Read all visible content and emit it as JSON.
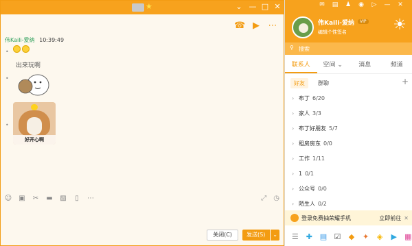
{
  "chat": {
    "sender": "伟Kaili-爱纳",
    "time": "10:39:49",
    "sticker_text": "出来玩啊",
    "photo_caption": "好开心啊",
    "close_label": "关闭(C)",
    "send_label": "发送(S)",
    "window_controls": [
      "⌄",
      "—",
      "□",
      "✕"
    ]
  },
  "qq": {
    "user_name": "伟Kaili-爱纳",
    "vip_badge": "VIP",
    "signature": "编辑个性签名",
    "search_placeholder": "搜索",
    "tabs": [
      "联系人",
      "空间 ⌄",
      "消息",
      "频道"
    ],
    "sub_tabs": [
      "好友",
      "群聊"
    ],
    "groups": [
      {
        "name": "布丁",
        "count": "6/20"
      },
      {
        "name": "家人",
        "count": "3/3"
      },
      {
        "name": "布丁好朋友",
        "count": "5/7"
      },
      {
        "name": "租房房东",
        "count": "0/0"
      },
      {
        "name": "工作",
        "count": "1/11"
      },
      {
        "name": "1",
        "count": "0/1"
      },
      {
        "name": "公众号",
        "count": "0/0"
      },
      {
        "name": "陌生人",
        "count": "0/2"
      }
    ],
    "promo_text": "登录免费抽荣耀手机",
    "promo_go": "立即前往",
    "colors": {
      "accent": "#f7a21d",
      "accent_dark": "#f39c12"
    }
  }
}
